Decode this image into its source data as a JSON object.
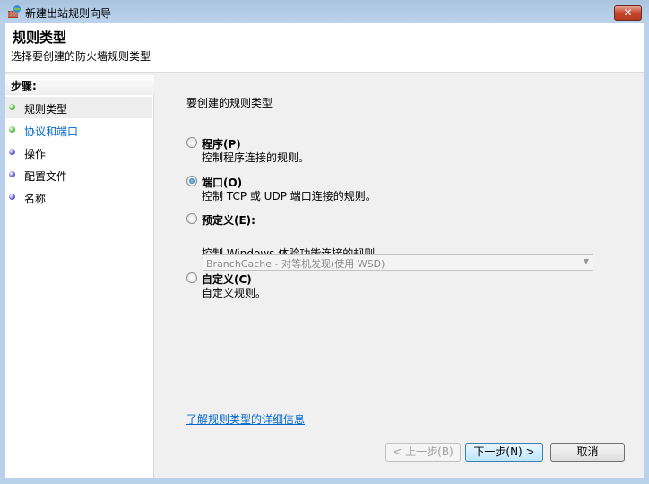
{
  "window": {
    "title": "新建出站规则向导",
    "close": "✕"
  },
  "header": {
    "title": "规则类型",
    "subtitle": "选择要创建的防火墙规则类型"
  },
  "steps": {
    "heading": "步骤:",
    "items": [
      {
        "label": "规则类型",
        "color": "#4cbb3c"
      },
      {
        "label": "协议和端口",
        "color": "#4cbb3c"
      },
      {
        "label": "操作",
        "color": "#5a5ac8"
      },
      {
        "label": "配置文件",
        "color": "#5a5ac8"
      },
      {
        "label": "名称",
        "color": "#5a5ac8"
      }
    ]
  },
  "main": {
    "prompt": "要创建的规则类型",
    "options": [
      {
        "label": "程序(P)",
        "desc": "控制程序连接的规则。",
        "selected": false
      },
      {
        "label": "端口(O)",
        "desc": "控制 TCP 或 UDP 端口连接的规则。",
        "selected": true
      },
      {
        "label": "预定义(E):",
        "desc": "控制 Windows 体验功能连接的规则。",
        "selected": false
      },
      {
        "label": "自定义(C)",
        "desc": "自定义规则。",
        "selected": false
      }
    ],
    "predefined_value": "BranchCache - 对等机发现(使用 WSD)",
    "link": "了解规则类型的详细信息"
  },
  "buttons": {
    "back": "< 上一步(B)",
    "next": "下一步(N) >",
    "cancel": "取消"
  }
}
